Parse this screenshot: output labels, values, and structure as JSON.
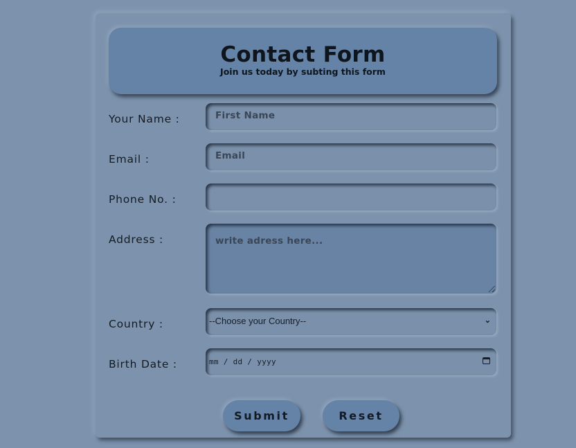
{
  "form": {
    "title": "Contact Form",
    "subtitle": "Join us today by subting this form",
    "fields": {
      "name": {
        "label": "Your Name :",
        "placeholder": "First Name",
        "value": ""
      },
      "email": {
        "label": "Email :",
        "placeholder": "Email",
        "value": ""
      },
      "phone": {
        "label": "Phone No. :",
        "placeholder": "",
        "value": ""
      },
      "address": {
        "label": "Address :",
        "placeholder": "write adress here...",
        "value": ""
      },
      "country": {
        "label": "Country :",
        "selected": "--Choose your Country--"
      },
      "birth_date": {
        "label": "Birth Date :",
        "placeholder": "mm / dd / yyyy"
      }
    },
    "buttons": {
      "submit": "Submit",
      "reset": "Reset"
    }
  },
  "icons": {
    "select_arrow": "chevron-down-icon",
    "date_picker": "calendar-icon"
  },
  "colors": {
    "background": "#7d93ad",
    "accent": "#6483a7",
    "text": "#131a22"
  }
}
